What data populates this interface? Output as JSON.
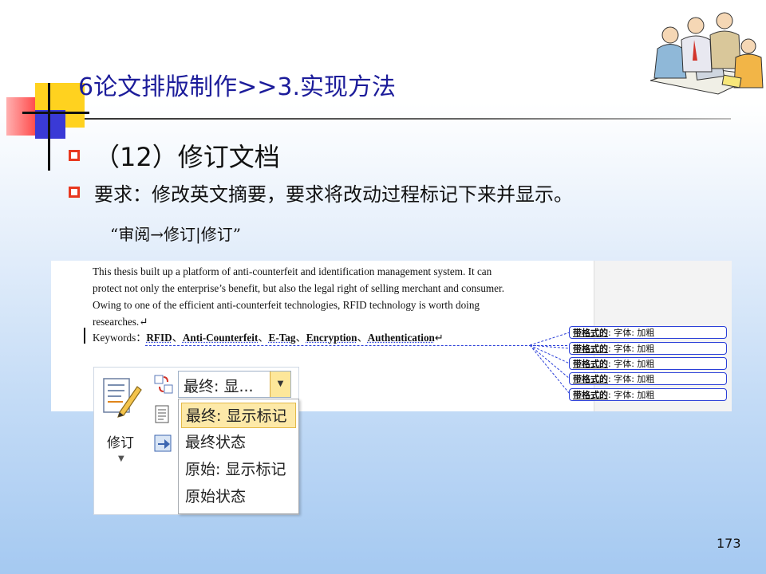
{
  "slide": {
    "title": "6论文排版制作>>3.实现方法",
    "bullet1": "（12）修订文档",
    "bullet2": "要求：修改英文摘要，要求将改动过程标记下来并显示。",
    "instruction": "“审阅→修订|修订”",
    "page_number": "173"
  },
  "document": {
    "lines": [
      "This thesis built up a platform of anti-counterfeit and identification management system. It can",
      "protect not only the enterprise’s benefit, but also the legal right of selling merchant and consumer.",
      "Owing to one of the efficient anti-counterfeit technologies, RFID technology is worth doing",
      "researches.↵"
    ],
    "keywords_label": "Keywords：",
    "keywords": [
      "RFID",
      "Anti-Counterfeit",
      "E-Tag",
      "Encryption",
      "Authentication"
    ],
    "keyword_separator": "、",
    "keywords_end": "↵",
    "comments": [
      {
        "prefix": "带格式的",
        "text": ": 字体: 加粗"
      },
      {
        "prefix": "带格式的",
        "text": ": 字体: 加粗"
      },
      {
        "prefix": "带格式的",
        "text": ": 字体: 加粗"
      },
      {
        "prefix": "带格式的",
        "text": ": 字体: 加粗"
      },
      {
        "prefix": "带格式的",
        "text": ": 字体: 加粗"
      }
    ],
    "accent_color": "#2b3fd8"
  },
  "ribbon": {
    "track_changes_label": "修订",
    "display_dropdown_value": "最终: 显...",
    "menu_items": [
      "最终: 显示标记",
      "最终状态",
      "原始: 显示标记",
      "原始状态"
    ],
    "selected_index": 0
  },
  "colors": {
    "title": "#1c1c9a",
    "bullet": "#e8381f",
    "menu_highlight": "#fde9a8"
  }
}
